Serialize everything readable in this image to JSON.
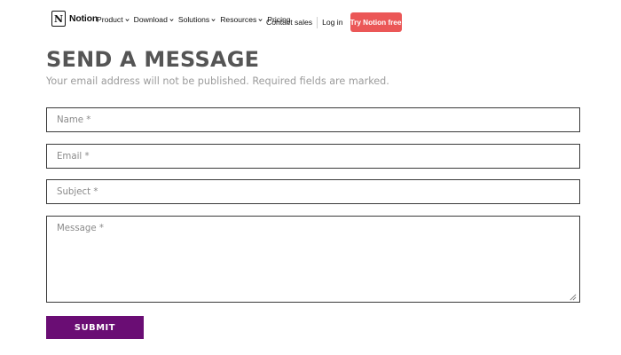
{
  "nav": {
    "brand": "Notion",
    "logo_glyph": "N",
    "items": [
      {
        "label": "Product",
        "has_dropdown": true
      },
      {
        "label": "Download",
        "has_dropdown": true
      },
      {
        "label": "Solutions",
        "has_dropdown": true
      },
      {
        "label": "Resources",
        "has_dropdown": true
      },
      {
        "label": "Pricing",
        "has_dropdown": false
      }
    ],
    "contact_sales": "Contact sales",
    "login": "Log in",
    "cta": "Try Notion free",
    "cta_color": "#eb5757"
  },
  "form": {
    "heading": "SEND A MESSAGE",
    "subheading": "Your email address will not be published. Required fields are marked.",
    "name_placeholder": "Name *",
    "email_placeholder": "Email *",
    "subject_placeholder": "Subject *",
    "message_placeholder": "Message *",
    "submit_label": "SUBMIT",
    "submit_color": "#6a0d74"
  }
}
